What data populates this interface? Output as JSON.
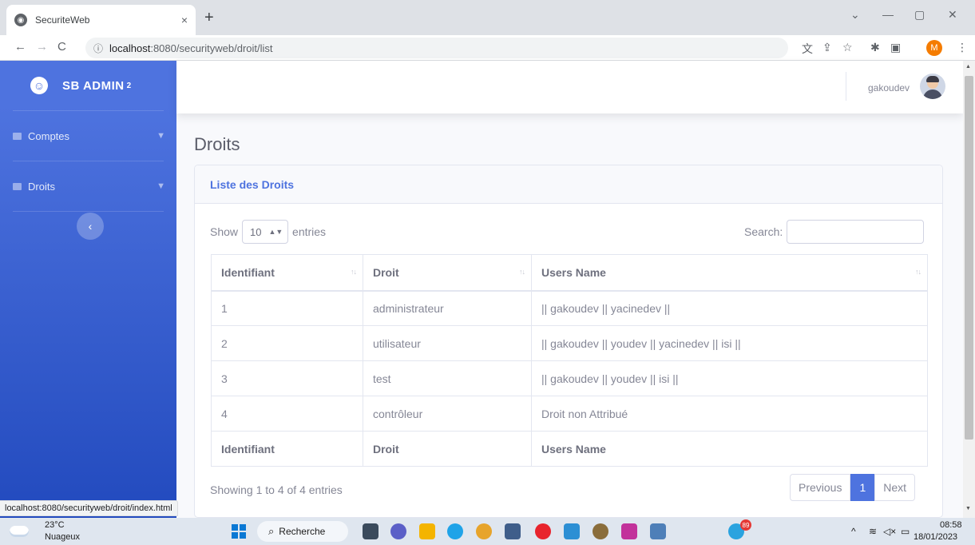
{
  "browser": {
    "tab_title": "SecuriteWeb",
    "tab_close": "×",
    "new_tab": "+",
    "url_host": "localhost",
    "url_path": ":8080/securityweb/droit/list",
    "status_url": "localhost:8080/securityweb/droit/index.html",
    "profile_initial": "M",
    "window_controls": {
      "collapse": "⌄",
      "minimize": "—",
      "restore": "▢",
      "close": "✕"
    },
    "nav": {
      "back": "←",
      "forward": "→",
      "reload": "C",
      "menu": "⋮"
    }
  },
  "sidebar": {
    "brand": "SB ADMIN",
    "brand_sup": "2",
    "items": [
      {
        "label": "Comptes"
      },
      {
        "label": "Droits"
      }
    ],
    "toggle": "‹"
  },
  "topbar": {
    "username": "gakoudev"
  },
  "page": {
    "title": "Droits",
    "card_title": "Liste des Droits"
  },
  "datatable": {
    "show_label": "Show",
    "entries_label": "entries",
    "page_length": "10",
    "search_label": "Search:",
    "search_value": "",
    "columns": [
      "Identifiant",
      "Droit",
      "Users Name"
    ],
    "rows": [
      [
        "1",
        "administrateur",
        "|| gakoudev || yacinedev ||"
      ],
      [
        "2",
        "utilisateur",
        "|| gakoudev || youdev || yacinedev || isi ||"
      ],
      [
        "3",
        "test",
        "|| gakoudev || youdev || isi ||"
      ],
      [
        "4",
        "contrôleur",
        "Droit non Attribué"
      ]
    ],
    "info": "Showing 1 to 4 of 4 entries",
    "pagination": {
      "previous": "Previous",
      "current": "1",
      "next": "Next"
    }
  },
  "taskbar": {
    "weather_temp": "23°C",
    "weather_desc": "Nuageux",
    "search_label": "Recherche",
    "telegram_badge": "89",
    "time": "08:58",
    "date": "18/01/2023"
  },
  "colors": {
    "primary": "#4e73df",
    "sidebar_bottom": "#224abe",
    "text_muted": "#858796"
  }
}
